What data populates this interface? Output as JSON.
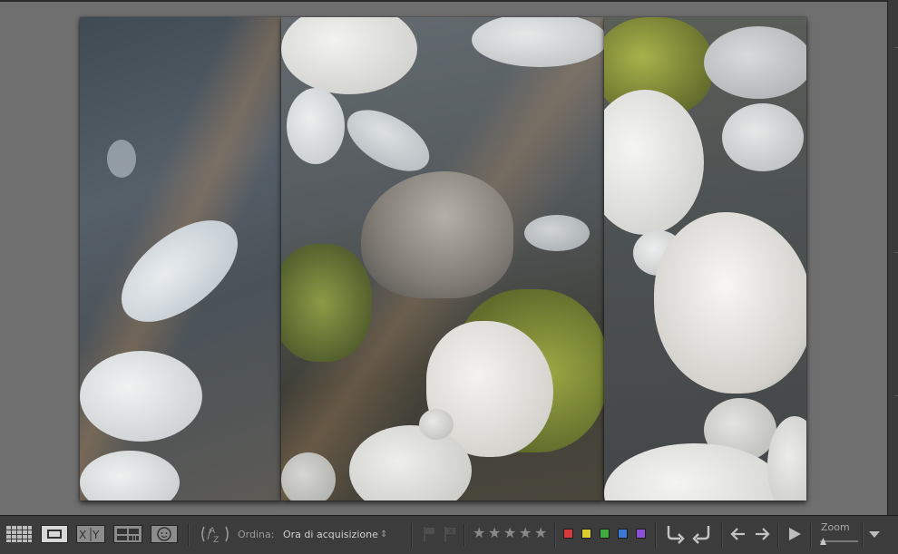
{
  "photos": [
    {
      "name": "photo-left",
      "alt": "Pebbles under clear water"
    },
    {
      "name": "photo-center",
      "alt": "Stone with moss at water edge"
    },
    {
      "name": "photo-right",
      "alt": "White pebbles with moss"
    }
  ],
  "toolbar": {
    "sort_label": "Ordina:",
    "sort_value": "Ora di acquisizione",
    "sort_arrows": "⇕",
    "view_compare": "X|Y",
    "stars": [
      "★",
      "★",
      "★",
      "★",
      "★"
    ],
    "color_labels": [
      "#d63a3a",
      "#d8cf2e",
      "#3dab3d",
      "#3d78d6",
      "#8b4fd6"
    ],
    "zoom_label": "Zoom"
  },
  "icons": {
    "grid": "grid-view-icon",
    "loupe": "loupe-view-icon",
    "compare": "compare-view-icon",
    "survey": "survey-view-icon",
    "people": "people-view-icon",
    "sort_az": "sort-az-icon",
    "flag": "flag-icon",
    "reject": "reject-flag-icon",
    "rotate_left": "rotate-left-icon",
    "rotate_right": "rotate-right-icon",
    "prev": "previous-arrow-icon",
    "next": "next-arrow-icon",
    "play": "play-slideshow-icon",
    "menu": "toolbar-menu-icon"
  }
}
